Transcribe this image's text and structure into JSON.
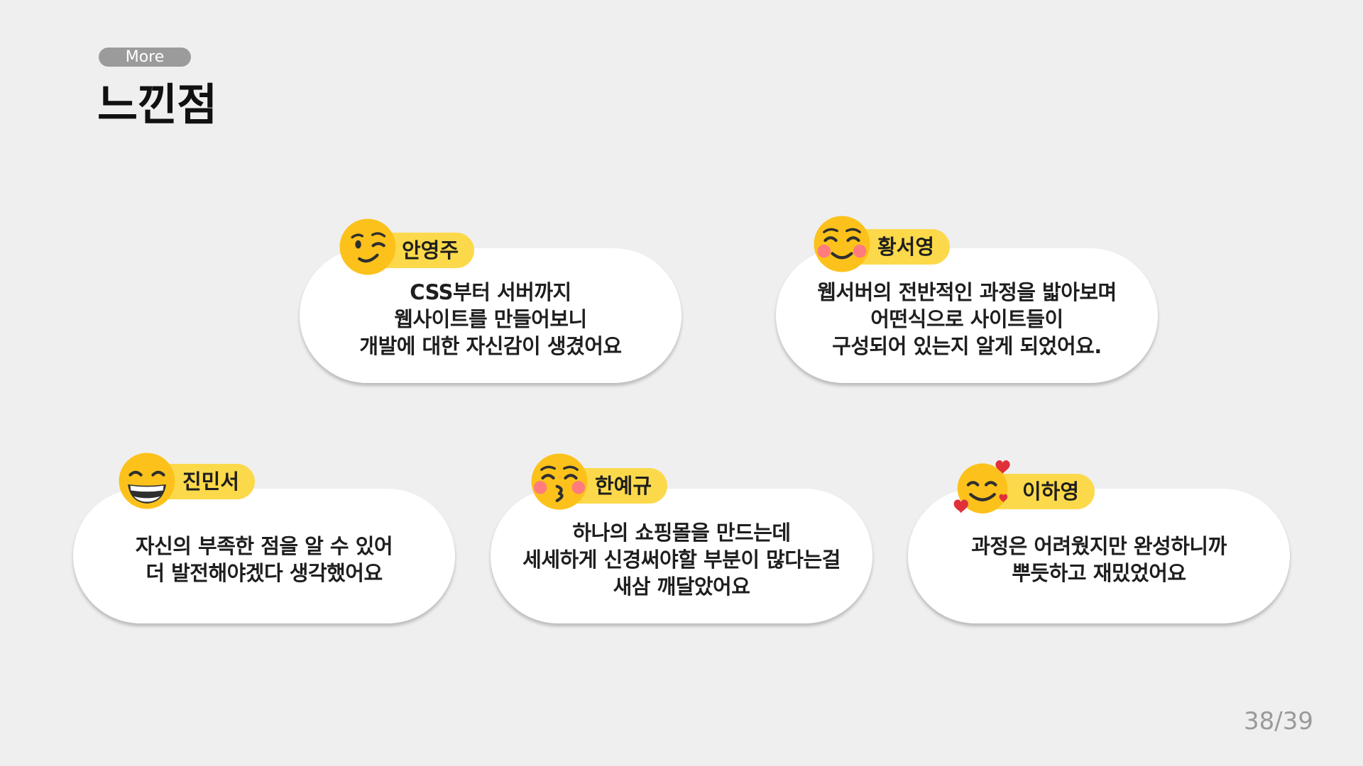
{
  "header": {
    "section_label": "More",
    "title": "느낀점"
  },
  "cards": [
    {
      "name": "안영주",
      "emoji": "winking-face-icon",
      "lines": [
        "CSS부터 서버까지",
        "웹사이트를 만들어보니",
        "개발에 대한 자신감이 생겼어요"
      ]
    },
    {
      "name": "황서영",
      "emoji": "smiling-face-icon",
      "lines": [
        "웹서버의 전반적인 과정을 밟아보며",
        "어떤식으로 사이트들이",
        "구성되어 있는지 알게 되었어요."
      ]
    },
    {
      "name": "진민서",
      "emoji": "grinning-face-icon",
      "lines": [
        "자신의 부족한 점을 알 수 있어",
        "더 발전해야겠다 생각했어요"
      ]
    },
    {
      "name": "한예규",
      "emoji": "kissing-face-icon",
      "lines": [
        "하나의 쇼핑몰을 만드는데",
        "세세하게 신경써야할 부분이 많다는걸",
        "새삼 깨달았어요"
      ]
    },
    {
      "name": "이하영",
      "emoji": "smiling-face-with-hearts-icon",
      "lines": [
        "과정은 어려웠지만 완성하니까",
        "뿌듯하고 재밌었어요"
      ]
    }
  ],
  "footer": {
    "page_number": "38/39"
  },
  "colors": {
    "background": "#efefef",
    "name_tag": "#fcd94a",
    "emoji_face": "#fcc21b",
    "pill": "#9b9b9b",
    "heart": "#e0303a"
  }
}
